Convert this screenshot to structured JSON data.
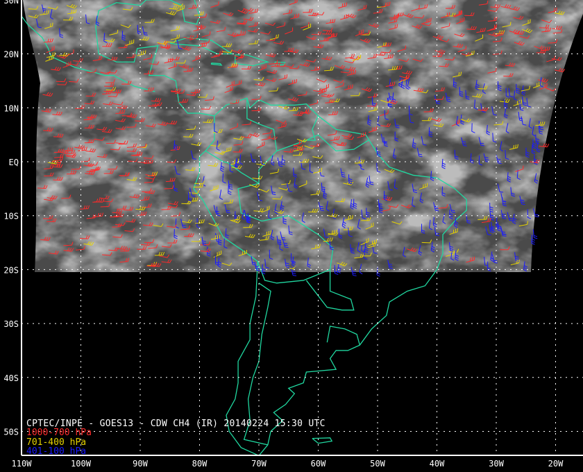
{
  "title": "CPTEC/INPE - GOES13 - CDW CH4 (IR) 20140224 15:30 UTC",
  "legend": [
    {
      "label": "1000-700 hPa",
      "color": "#ff2a2a"
    },
    {
      "label": "701-400 hPa",
      "color": "#e6d200"
    },
    {
      "label": "401-100 hPa",
      "color": "#1a1aff"
    }
  ],
  "axes": {
    "lon_ticks": [
      "110W",
      "100W",
      "90W",
      "80W",
      "70W",
      "60W",
      "50W",
      "40W",
      "30W",
      "20W"
    ],
    "lat_ticks": [
      "30N",
      "20N",
      "10N",
      "EQ",
      "10S",
      "20S",
      "30S",
      "40S",
      "50S"
    ]
  },
  "colors": {
    "coastline": "#20d8a0",
    "grid": "#ffffff",
    "frame": "#ffffff"
  }
}
